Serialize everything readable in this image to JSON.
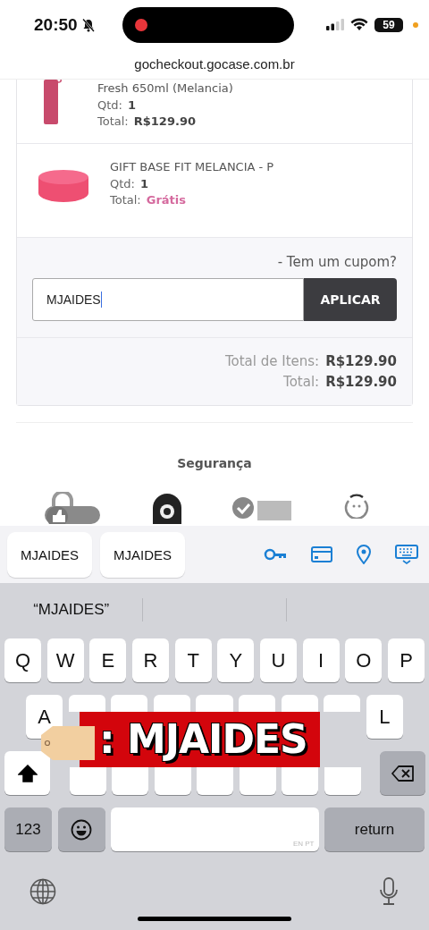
{
  "status_bar": {
    "time": "20:50",
    "battery": "59"
  },
  "url_bar": {
    "url": "gocheckout.gocase.com.br"
  },
  "cart": {
    "items": [
      {
        "kind": "bottle",
        "name": "Fresh 650ml (Melancia)",
        "qty_label": "Qtd:",
        "qty": "1",
        "total_label": "Total:",
        "total": "R$129.90",
        "free": false
      },
      {
        "kind": "base",
        "name": "GIFT BASE FIT MELANCIA - P",
        "qty_label": "Qtd:",
        "qty": "1",
        "total_label": "Total:",
        "total": "Grátis",
        "free": true
      }
    ],
    "coupon": {
      "prompt": "- Tem um cupom?",
      "value": "MJAIDES",
      "button": "APLICAR"
    },
    "totals": [
      {
        "label": "Total de Itens:",
        "value": "R$129.90"
      },
      {
        "label": "Total:",
        "value": "R$129.90"
      }
    ]
  },
  "security": {
    "title": "Segurança",
    "badges": [
      {
        "kind": "lock"
      },
      {
        "kind": "seal"
      },
      {
        "kind": "rosette"
      },
      {
        "kind": "face"
      }
    ]
  },
  "keyboard": {
    "autofill": [
      "MJAIDES",
      "MJAIDES"
    ],
    "tools": [
      {
        "kind": "key"
      },
      {
        "kind": "card"
      },
      {
        "kind": "pin"
      },
      {
        "kind": "keyboard"
      }
    ],
    "suggestions": [
      "“MJAIDES”"
    ],
    "key_rows": [
      {
        "keys": [
          {
            "kind": "letter",
            "label": "Q"
          },
          {
            "kind": "letter",
            "label": "W"
          },
          {
            "kind": "letter",
            "label": "E"
          },
          {
            "kind": "letter",
            "label": "R"
          },
          {
            "kind": "letter",
            "label": "T"
          },
          {
            "kind": "letter",
            "label": "Y"
          },
          {
            "kind": "letter",
            "label": "U"
          },
          {
            "kind": "letter",
            "label": "I"
          },
          {
            "kind": "letter",
            "label": "O"
          },
          {
            "kind": "letter",
            "label": "P"
          }
        ]
      },
      {
        "keys": [
          {
            "kind": "letter",
            "label": "A"
          },
          {
            "kind": "hidden"
          },
          {
            "kind": "hidden"
          },
          {
            "kind": "hidden"
          },
          {
            "kind": "hidden"
          },
          {
            "kind": "hidden"
          },
          {
            "kind": "hidden"
          },
          {
            "kind": "hidden"
          },
          {
            "kind": "letter",
            "label": "L"
          }
        ]
      },
      {
        "keys": [
          {
            "kind": "shift",
            "on": true
          },
          {
            "kind": "hidden"
          },
          {
            "kind": "hidden"
          },
          {
            "kind": "hidden"
          },
          {
            "kind": "hidden"
          },
          {
            "kind": "hidden"
          },
          {
            "kind": "hidden"
          },
          {
            "kind": "hidden"
          },
          {
            "kind": "delete"
          }
        ]
      },
      {
        "keys": [
          {
            "kind": "numbers",
            "label": "123"
          },
          {
            "kind": "emoji"
          },
          {
            "kind": "space",
            "hint": "EN PT"
          },
          {
            "kind": "return",
            "label": "return"
          }
        ]
      }
    ]
  },
  "overlay": {
    "text": ": MJAIDES"
  }
}
